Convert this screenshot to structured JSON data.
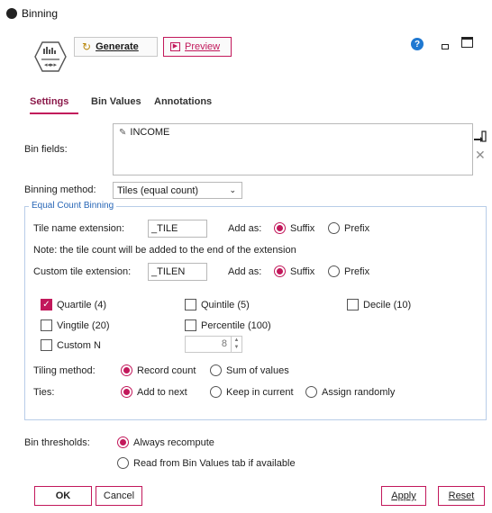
{
  "window": {
    "title": "Binning"
  },
  "toolbar": {
    "generate_label": "Generate",
    "preview_label": "Preview"
  },
  "tabs": [
    {
      "label": "Settings",
      "active": true
    },
    {
      "label": "Bin Values",
      "active": false
    },
    {
      "label": "Annotations",
      "active": false
    }
  ],
  "bin_fields": {
    "label": "Bin fields:",
    "items": [
      "INCOME"
    ]
  },
  "binning_method": {
    "label": "Binning method:",
    "value": "Tiles (equal count)"
  },
  "equal_count": {
    "legend": "Equal Count Binning",
    "tile_name_ext_label": "Tile name extension:",
    "tile_name_ext_value": "_TILE",
    "add_as_label": "Add as:",
    "suffix_label": "Suffix",
    "prefix_label": "Prefix",
    "note": "Note: the tile count will be added to the end of the extension",
    "custom_ext_label": "Custom tile extension:",
    "custom_ext_value": "_TILEN",
    "tiles": [
      {
        "label": "Quartile (4)",
        "checked": true
      },
      {
        "label": "Quintile (5)",
        "checked": false
      },
      {
        "label": "Decile (10)",
        "checked": false
      },
      {
        "label": "Vingtile (20)",
        "checked": false
      },
      {
        "label": "Percentile (100)",
        "checked": false
      },
      {
        "label": "Custom N",
        "checked": false
      }
    ],
    "custom_n_value": "8",
    "tiling_method_label": "Tiling method:",
    "tiling_options": [
      "Record count",
      "Sum of values"
    ],
    "ties_label": "Ties:",
    "ties_options": [
      "Add to next",
      "Keep in current",
      "Assign randomly"
    ]
  },
  "thresholds": {
    "label": "Bin thresholds:",
    "options": [
      "Always recompute",
      "Read from Bin Values tab if available"
    ]
  },
  "footer": {
    "ok": "OK",
    "cancel": "Cancel",
    "apply": "Apply",
    "reset": "Reset"
  },
  "colors": {
    "accent": "#c2185b",
    "legend_blue": "#2766b6",
    "help_blue": "#1f78d1"
  }
}
